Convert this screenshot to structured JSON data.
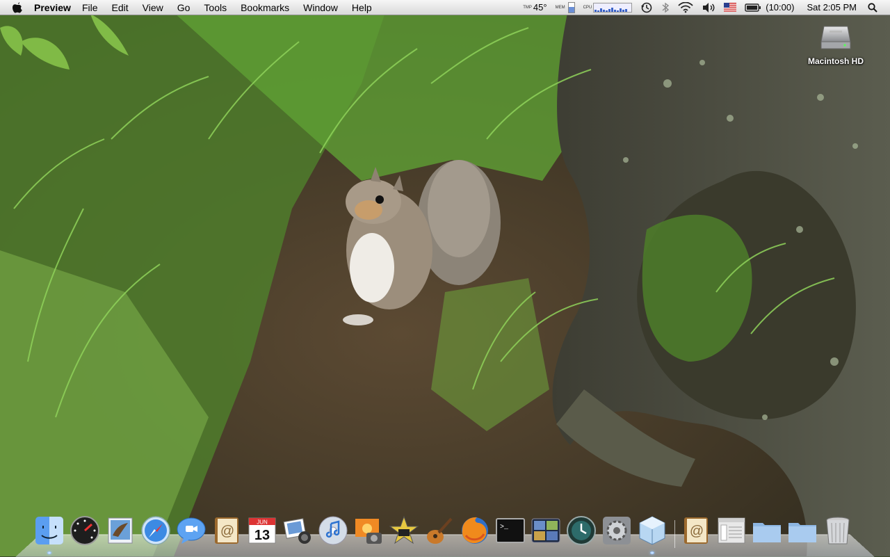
{
  "menubar": {
    "app_name": "Preview",
    "menus": [
      "File",
      "Edit",
      "View",
      "Go",
      "Tools",
      "Bookmarks",
      "Window",
      "Help"
    ],
    "status": {
      "temp_label": "TMP",
      "temp_value": "45°",
      "mem_label": "MEM",
      "cpu_label": "CPU",
      "battery_time": "(10:00)",
      "clock": "Sat 2:05 PM"
    },
    "status_icons": [
      "time-machine-icon",
      "bluetooth-icon",
      "wifi-icon",
      "volume-icon",
      "us-flag-input-icon",
      "battery-icon",
      "spotlight-icon"
    ]
  },
  "desktop": {
    "icons": [
      {
        "label": "Macintosh HD",
        "icon": "hard-drive-icon"
      }
    ]
  },
  "dock": {
    "apps": [
      {
        "name": "Finder",
        "icon": "finder-icon",
        "running": true
      },
      {
        "name": "Dashboard",
        "icon": "dashboard-icon",
        "running": false
      },
      {
        "name": "Mail",
        "icon": "mail-icon",
        "running": false
      },
      {
        "name": "Safari",
        "icon": "safari-icon",
        "running": false
      },
      {
        "name": "iChat",
        "icon": "ichat-icon",
        "running": false
      },
      {
        "name": "Address Book",
        "icon": "address-book-icon",
        "running": false
      },
      {
        "name": "iCal",
        "icon": "ical-icon",
        "running": false,
        "month": "JUN",
        "day": "13"
      },
      {
        "name": "iPhoto",
        "icon": "iphoto-icon",
        "running": false
      },
      {
        "name": "iTunes",
        "icon": "itunes-icon",
        "running": false
      },
      {
        "name": "Photo Booth",
        "icon": "photo-booth-icon",
        "running": false
      },
      {
        "name": "iMovie",
        "icon": "imovie-icon",
        "running": false
      },
      {
        "name": "GarageBand",
        "icon": "garageband-icon",
        "running": false
      },
      {
        "name": "Firefox",
        "icon": "firefox-icon",
        "running": false
      },
      {
        "name": "Terminal",
        "icon": "terminal-icon",
        "running": false
      },
      {
        "name": "Spaces",
        "icon": "spaces-icon",
        "running": false
      },
      {
        "name": "Time Machine",
        "icon": "time-machine-dock-icon",
        "running": false
      },
      {
        "name": "System Preferences",
        "icon": "system-preferences-icon",
        "running": false
      },
      {
        "name": "Preview",
        "icon": "preview-cube-icon",
        "running": true
      }
    ],
    "stacks": [
      {
        "name": "Address Book",
        "icon": "address-book-stack-icon"
      },
      {
        "name": "Documents",
        "icon": "documents-icon"
      },
      {
        "name": "Folder",
        "icon": "folder-icon"
      },
      {
        "name": "Downloads",
        "icon": "downloads-folder-icon"
      },
      {
        "name": "Trash",
        "icon": "trash-icon"
      }
    ]
  }
}
